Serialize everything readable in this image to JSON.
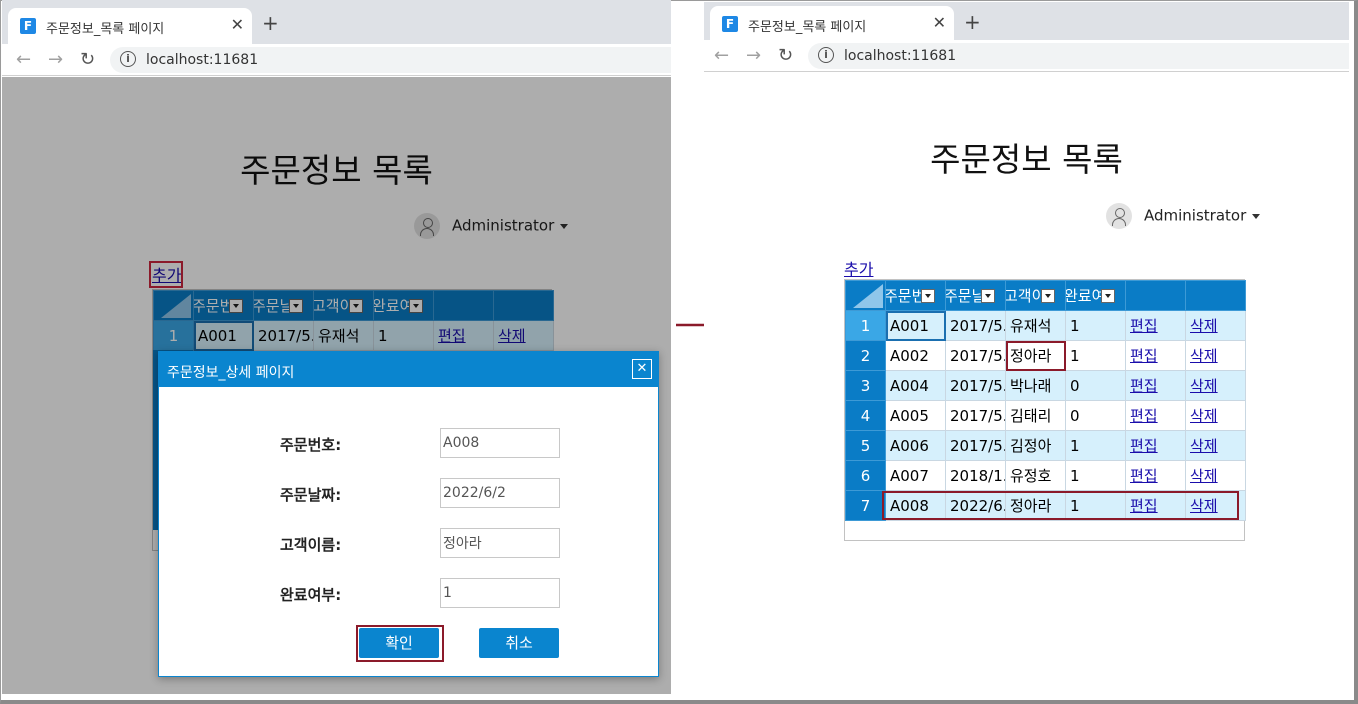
{
  "browser": {
    "tab_title": "주문정보_목록 페이지",
    "favicon": "F",
    "close": "✕",
    "new_tab": "+",
    "url": "localhost:11681",
    "info": "i"
  },
  "page": {
    "title": "주문정보 목록",
    "user": "Administrator",
    "add_link": "추가"
  },
  "grid": {
    "headers": [
      "주문번호",
      "주문날짜",
      "고객이름",
      "완료여부"
    ],
    "rows": [
      {
        "no": "1",
        "order": "A001",
        "date": "2017/5...",
        "customer": "유재석",
        "done": "1",
        "edit": "편집",
        "del": "삭제"
      },
      {
        "no": "2",
        "order": "A002",
        "date": "2017/5...",
        "customer": "정아라",
        "done": "1",
        "edit": "편집",
        "del": "삭제"
      },
      {
        "no": "3",
        "order": "A004",
        "date": "2017/5...",
        "customer": "박나래",
        "done": "0",
        "edit": "편집",
        "del": "삭제"
      },
      {
        "no": "4",
        "order": "A005",
        "date": "2017/5...",
        "customer": "김태리",
        "done": "0",
        "edit": "편집",
        "del": "삭제"
      },
      {
        "no": "5",
        "order": "A006",
        "date": "2017/5...",
        "customer": "김정아",
        "done": "1",
        "edit": "편집",
        "del": "삭제"
      },
      {
        "no": "6",
        "order": "A007",
        "date": "2018/1...",
        "customer": "유정호",
        "done": "1",
        "edit": "편집",
        "del": "삭제"
      },
      {
        "no": "7",
        "order": "A008",
        "date": "2022/6...",
        "customer": "정아라",
        "done": "1",
        "edit": "편집",
        "del": "삭제"
      }
    ]
  },
  "dialog": {
    "title": "주문정보_상세 페이지",
    "close": "✕",
    "fields": [
      {
        "label": "주문번호:",
        "value": "A008"
      },
      {
        "label": "주문날짜:",
        "value": "2022/6/2"
      },
      {
        "label": "고객이름:",
        "value": "정아라"
      },
      {
        "label": "완료여부:",
        "value": "1"
      }
    ],
    "confirm": "확인",
    "cancel": "취소"
  },
  "colors": {
    "grid_header": "#0a7cc6",
    "row_alt": "#d6f0fc",
    "highlight": "#8b1a2a",
    "dialog": "#0a85cf"
  }
}
